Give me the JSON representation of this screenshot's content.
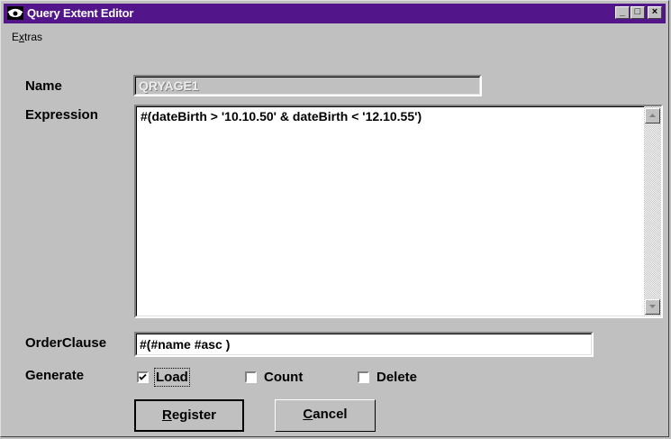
{
  "window": {
    "title": "Query Extent Editor",
    "title_bg": "#52168a"
  },
  "titlebar_buttons": {
    "minimize": "_",
    "maximize": "□",
    "close": "×"
  },
  "menu": {
    "items": [
      {
        "label": "Extras",
        "mnemonic": "x"
      }
    ]
  },
  "form": {
    "name": {
      "label": "Name",
      "value": "QRYAGE1",
      "disabled": true
    },
    "expression": {
      "label": "Expression",
      "value": "#(dateBirth > '10.10.50' & dateBirth < '12.10.55')"
    },
    "order_clause": {
      "label": "OrderClause",
      "value": "#(#name #asc )"
    },
    "generate": {
      "label": "Generate",
      "options": [
        {
          "label": "Load",
          "checked": true
        },
        {
          "label": "Count",
          "checked": false
        },
        {
          "label": "Delete",
          "checked": false
        }
      ]
    }
  },
  "buttons": {
    "register": "Register",
    "cancel": "Cancel"
  }
}
